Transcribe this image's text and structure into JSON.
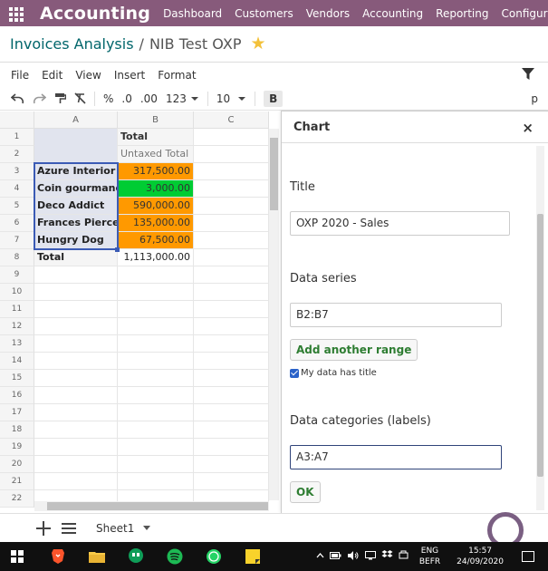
{
  "navbar": {
    "brand": "Accounting",
    "menu": [
      "Dashboard",
      "Customers",
      "Vendors",
      "Accounting",
      "Reporting",
      "Configuration"
    ]
  },
  "breadcrumb": {
    "parent": "Invoices Analysis",
    "separator": "/",
    "current": "NIB Test OXP"
  },
  "menubar": [
    "File",
    "Edit",
    "View",
    "Insert",
    "Format"
  ],
  "toolbar": {
    "percent": "%",
    "dec_less": ".0",
    "dec_more": ".00",
    "format": "123",
    "font_size": "10",
    "bold": "B",
    "overflow": "p"
  },
  "grid": {
    "columns": [
      "A",
      "B",
      "C"
    ],
    "rows": [
      "1",
      "2",
      "3",
      "4",
      "5",
      "6",
      "7",
      "8",
      "9",
      "10",
      "11",
      "12",
      "13",
      "14",
      "15",
      "16",
      "17",
      "18",
      "19",
      "20",
      "21",
      "22"
    ],
    "header_total": "Total",
    "header_untaxed": "Untaxed Total",
    "entries": [
      {
        "name": "Azure Interior",
        "value": "317,500.00"
      },
      {
        "name": "Coin gourmand",
        "value": "3,000.00"
      },
      {
        "name": "Deco Addict",
        "value": "590,000.00"
      },
      {
        "name": "Frances Pierce",
        "value": "135,000.00"
      },
      {
        "name": "Hungry Dog",
        "value": "67,500.00"
      }
    ],
    "total_label": "Total",
    "total_value": "1,113,000.00"
  },
  "colors": {
    "navbar": "#875a7b",
    "orange": "#ff9900",
    "green": "#00cc33",
    "label_bg": "#e1e4ee",
    "header_bg": "#f5f5f5"
  },
  "chart_panel": {
    "title": "Chart",
    "close": "×",
    "title_label": "Title",
    "title_value": "OXP 2020 - Sales",
    "series_label": "Data series",
    "series_value": "B2:B7",
    "add_range": "Add another range",
    "has_title_label": "My data has title",
    "categories_label": "Data categories (labels)",
    "categories_value": "A3:A7",
    "ok": "OK"
  },
  "sheets": {
    "active": "Sheet1"
  },
  "taskbar": {
    "lang_top": "ENG",
    "lang_bottom": "BEFR",
    "time": "15:57",
    "date": "24/09/2020"
  }
}
